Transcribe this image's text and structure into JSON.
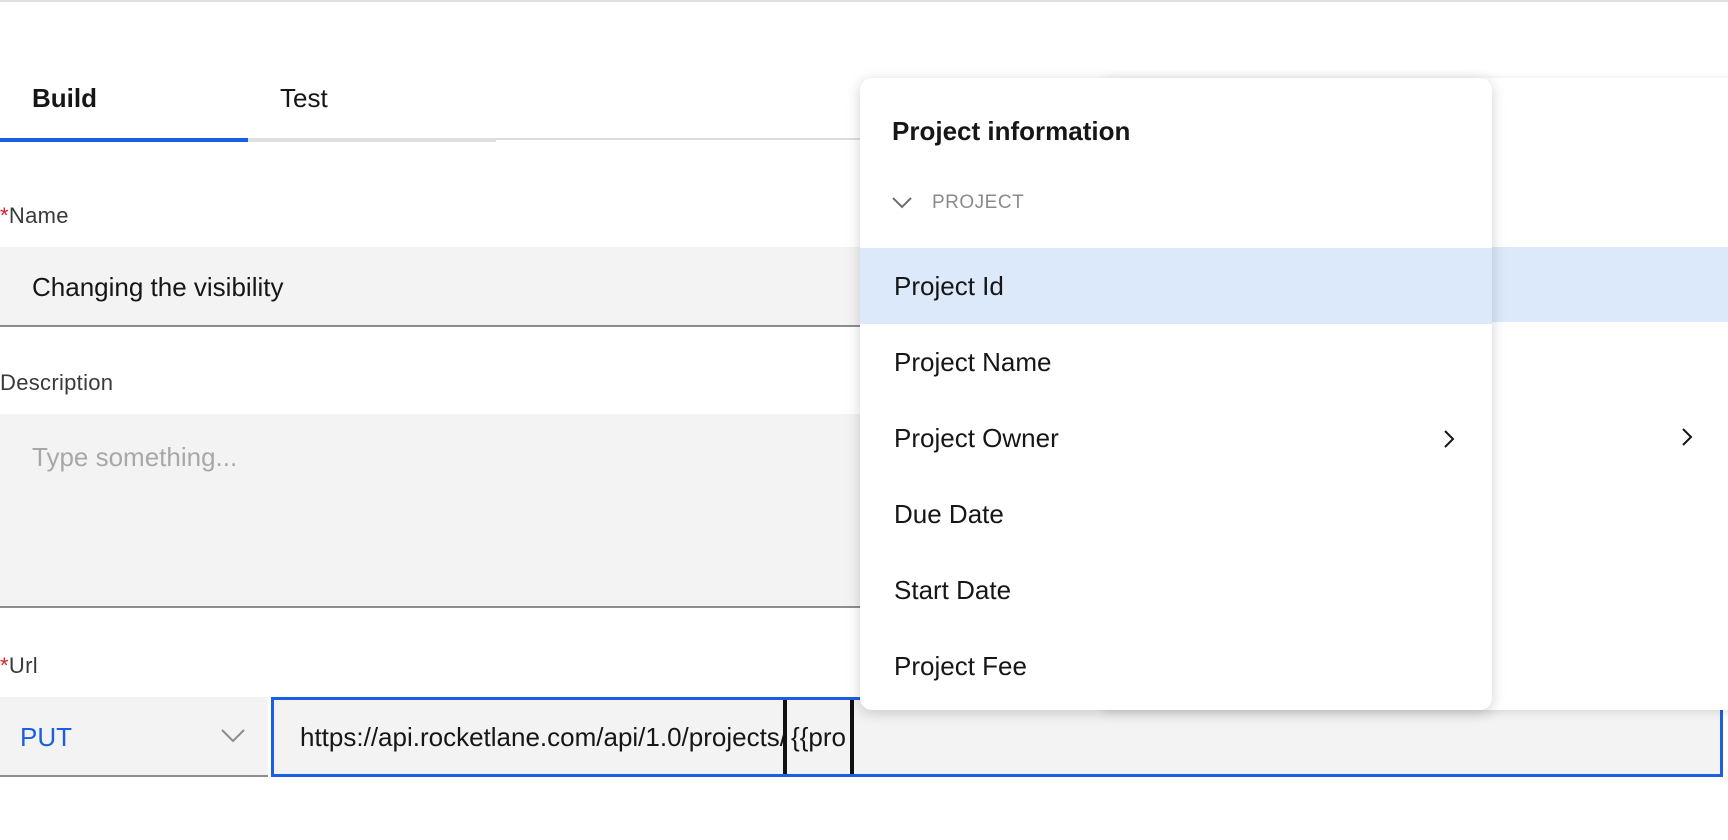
{
  "tabs": [
    {
      "label": "Build",
      "active": true
    },
    {
      "label": "Test",
      "active": false
    }
  ],
  "form": {
    "name_label": "Name",
    "name_value": "Changing the visibility",
    "description_label": "Description",
    "description_placeholder": "Type something...",
    "url_label": "Url",
    "required_marker": "*",
    "method_value": "PUT",
    "url_value": "https://api.rocketlane.com/api/1.0/projects/",
    "url_token": "{{pro"
  },
  "dropdown": {
    "title": "Project information",
    "group_label": "PROJECT",
    "items": [
      {
        "label": "Project Id",
        "active": true,
        "has_submenu": false
      },
      {
        "label": "Project Name",
        "active": false,
        "has_submenu": false
      },
      {
        "label": "Project Owner",
        "active": false,
        "has_submenu": true
      },
      {
        "label": "Due Date",
        "active": false,
        "has_submenu": false
      },
      {
        "label": "Start Date",
        "active": false,
        "has_submenu": false
      },
      {
        "label": "Project Fee",
        "active": false,
        "has_submenu": false
      }
    ]
  },
  "icons": {
    "method_chevron": "chevron-down-icon",
    "group_chevron": "chevron-down-icon",
    "submenu_chevron": "chevron-right-icon"
  },
  "colors": {
    "accent": "#1a5fe3",
    "highlight": "#dbe9fb",
    "required": "#da1e28"
  }
}
